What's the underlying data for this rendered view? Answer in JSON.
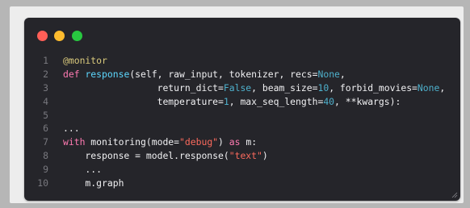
{
  "colors": {
    "page_bg": "#b6b6b6",
    "frame_bg": "#ededed",
    "window_bg": "#25252a",
    "light_red": "#ff5f57",
    "light_yellow": "#febc2e",
    "light_green": "#28c840",
    "line_number": "#78787e",
    "text": "#f0f0f2",
    "keyword": "#ff7ab2",
    "function": "#5dd8ff",
    "decorator": "#d9c97c",
    "string": "#fc6a5d",
    "literal": "#4eb0cc"
  },
  "window": {
    "traffic_lights": [
      "close",
      "minimize",
      "zoom"
    ]
  },
  "code": {
    "lines": [
      {
        "n": "1",
        "tokens": [
          {
            "t": "@monitor",
            "c": "decorator"
          }
        ]
      },
      {
        "n": "2",
        "tokens": [
          {
            "t": "def ",
            "c": "keyword"
          },
          {
            "t": "response",
            "c": "function"
          },
          {
            "t": "(self, raw_input, tokenizer, recs=",
            "c": "text"
          },
          {
            "t": "None",
            "c": "literal"
          },
          {
            "t": ",",
            "c": "text"
          }
        ]
      },
      {
        "n": "3",
        "tokens": [
          {
            "t": "                 return_dict=",
            "c": "text"
          },
          {
            "t": "False",
            "c": "literal"
          },
          {
            "t": ", beam_size=",
            "c": "text"
          },
          {
            "t": "10",
            "c": "literal"
          },
          {
            "t": ", forbid_movies=",
            "c": "text"
          },
          {
            "t": "None",
            "c": "literal"
          },
          {
            "t": ",",
            "c": "text"
          }
        ]
      },
      {
        "n": "4",
        "tokens": [
          {
            "t": "                 temperature=",
            "c": "text"
          },
          {
            "t": "1",
            "c": "literal"
          },
          {
            "t": ", max_seq_length=",
            "c": "text"
          },
          {
            "t": "40",
            "c": "literal"
          },
          {
            "t": ", **kwargs):",
            "c": "text"
          }
        ]
      },
      {
        "n": "5",
        "tokens": []
      },
      {
        "n": "6",
        "tokens": [
          {
            "t": "...",
            "c": "text"
          }
        ]
      },
      {
        "n": "7",
        "tokens": [
          {
            "t": "with ",
            "c": "keyword"
          },
          {
            "t": "monitoring(mode=",
            "c": "text"
          },
          {
            "t": "\"debug\"",
            "c": "string"
          },
          {
            "t": ") ",
            "c": "text"
          },
          {
            "t": "as ",
            "c": "keyword"
          },
          {
            "t": "m:",
            "c": "text"
          }
        ]
      },
      {
        "n": "8",
        "tokens": [
          {
            "t": "    response = model.response(",
            "c": "text"
          },
          {
            "t": "\"text\"",
            "c": "string"
          },
          {
            "t": ")",
            "c": "text"
          }
        ]
      },
      {
        "n": "9",
        "tokens": [
          {
            "t": "    ...",
            "c": "text"
          }
        ]
      },
      {
        "n": "10",
        "tokens": [
          {
            "t": "    m.graph",
            "c": "text"
          }
        ]
      }
    ]
  }
}
